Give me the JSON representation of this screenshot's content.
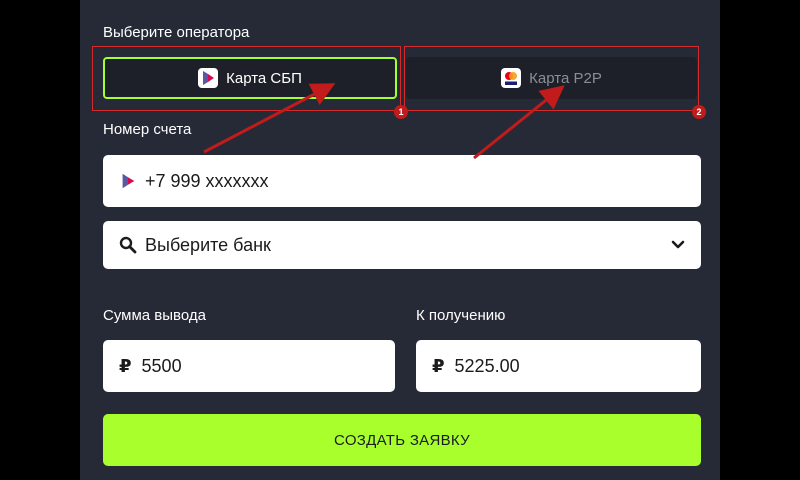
{
  "form": {
    "operator_label": "Выберите оператора",
    "operators": [
      {
        "label": "Карта СБП",
        "icon": "sbp-logo-icon",
        "selected": true
      },
      {
        "label": "Карта P2P",
        "icon": "mastercard-visa-icon",
        "selected": false
      }
    ],
    "account_label": "Номер счета",
    "account_value": "+7 999 xxxxxxx",
    "bank_placeholder": "Выберите банк",
    "withdraw_label": "Сумма вывода",
    "withdraw_currency": "₽",
    "withdraw_value": "5500",
    "receive_label": "К получению",
    "receive_currency": "₽",
    "receive_value": "5225.00",
    "submit_label": "СОЗДАТЬ ЗАЯВКУ"
  },
  "annotations": {
    "marker_1": "1",
    "marker_2": "2"
  },
  "colors": {
    "panel_bg": "#262a36",
    "accent": "#a8ff2c",
    "annotation_red": "#d42a2a"
  }
}
